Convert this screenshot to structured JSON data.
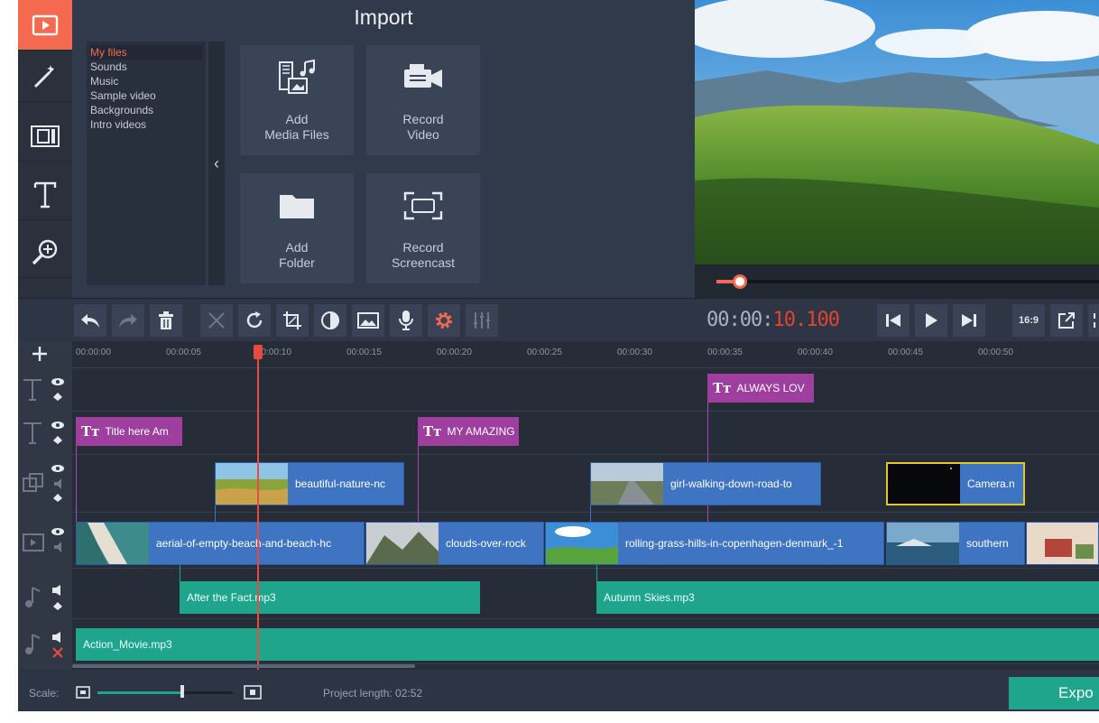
{
  "colors": {
    "accent": "#f4694f",
    "title_clip": "#9e3f9f",
    "video_clip": "#3e74c1",
    "audio_clip": "#1ea58c",
    "playhead": "#e84b3c"
  },
  "sidebar": {
    "items": [
      {
        "icon": "import-icon",
        "active": true
      },
      {
        "icon": "magic-wand-icon",
        "active": false
      },
      {
        "icon": "transitions-icon",
        "active": false
      },
      {
        "icon": "titles-icon",
        "active": false
      },
      {
        "icon": "zoom-icon",
        "active": false
      },
      {
        "icon": "more-tools-icon",
        "active": false
      }
    ]
  },
  "import_panel": {
    "title": "Import",
    "file_list": [
      "My files",
      "Sounds",
      "Music",
      "Sample video",
      "Backgrounds",
      "Intro videos"
    ],
    "selected_file_item": "My files",
    "tiles": {
      "add_media": [
        "Add",
        "Media Files"
      ],
      "record_video": [
        "Record",
        "Video"
      ],
      "add_folder": [
        "Add",
        "Folder"
      ],
      "record_screencast": [
        "Record",
        "Screencast"
      ]
    }
  },
  "player": {
    "timecode_elapsed": "00:00:",
    "timecode_highlight": "10.100",
    "aspect_ratio": "16:9",
    "seek_progress_fraction": 0.07
  },
  "toolbar": {
    "icons": [
      "undo-icon",
      "redo-icon",
      "delete-icon",
      "cut-icon",
      "rotate-icon",
      "crop-icon",
      "color-adjust-icon",
      "image-icon",
      "microphone-icon",
      "settings-icon",
      "equalizer-icon"
    ]
  },
  "timeline": {
    "ruler": [
      "00:00:00",
      "00:00:05",
      "00:00:10",
      "00:00:15",
      "00:00:20",
      "00:00:25",
      "00:00:30",
      "00:00:35",
      "00:00:40",
      "00:00:45",
      "00:00:50"
    ],
    "playhead_time": "00:00:10.100",
    "title_clips": [
      {
        "label": "Title here Am",
        "track": 2
      },
      {
        "label": "MY AMAZING",
        "track": 2
      },
      {
        "label": "ALWAYS LOV",
        "track": 1
      }
    ],
    "overlay_clips": [
      "beautiful-nature-nc",
      "girl-walking-down-road-to",
      "Camera.n"
    ],
    "main_clips": [
      "aerial-of-empty-beach-and-beach-hc",
      "clouds-over-rock",
      "rolling-grass-hills-in-copenhagen-denmark_-1",
      "southern",
      ""
    ],
    "audio_clips": [
      "After the Fact.mp3",
      "Autumn Skies.mp3",
      "Action_Movie.mp3"
    ]
  },
  "statusbar": {
    "scale_label": "Scale:",
    "scale_fraction": 0.62,
    "project_length": "Project length:  02:52",
    "export_label": "Expo"
  }
}
